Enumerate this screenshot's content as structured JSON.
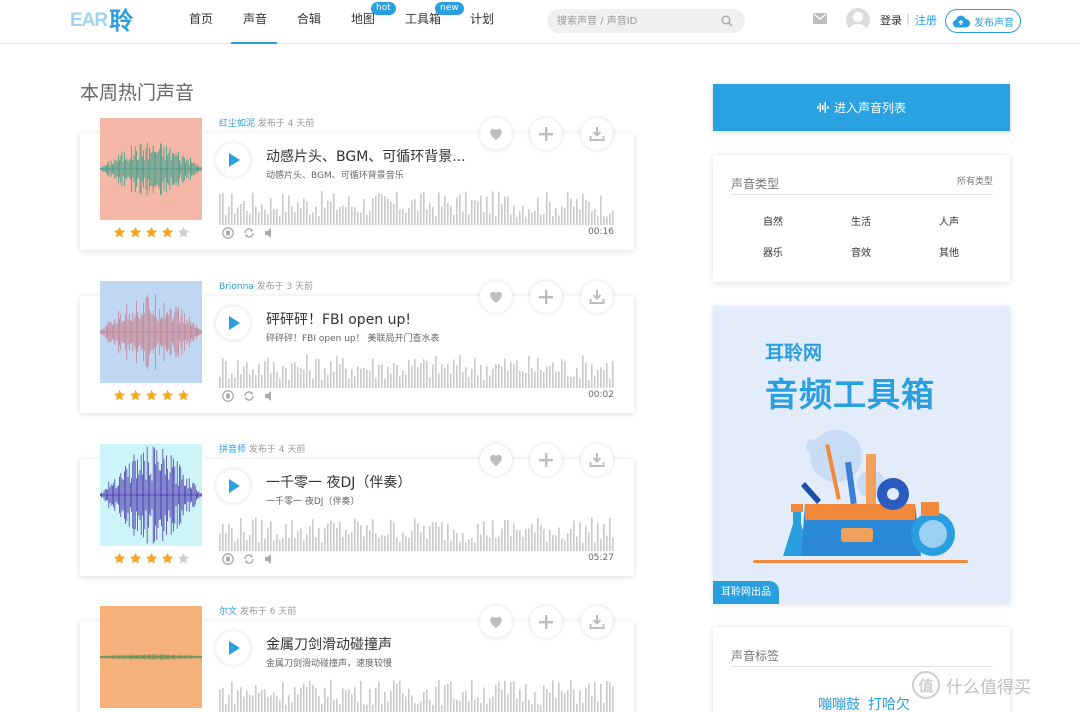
{
  "nav": {
    "logo_text": "EAR",
    "logo_char": "聆",
    "items": [
      {
        "label": "首页"
      },
      {
        "label": "声音"
      },
      {
        "label": "合辑"
      },
      {
        "label": "地图",
        "badge": "hot"
      },
      {
        "label": "工具箱",
        "badge": "new"
      },
      {
        "label": "计划"
      }
    ],
    "search_placeholder": "搜索声音 / 声音ID",
    "login": "登录",
    "separator": "|",
    "register": "注册",
    "publish": "发布声音"
  },
  "section_title": "本周热门声音",
  "sounds": [
    {
      "author": "红尘如泥",
      "posted": "发布于 4 天前",
      "title": "动感片头、BGM、可循环背景...",
      "subtitle": "动感片头、BGM、可循环背景音乐",
      "duration": "00:16",
      "rating": 4,
      "cover_bg": "#f6b8a6",
      "cover_wave": "#1c9c88"
    },
    {
      "author": "Brionna",
      "posted": "发布于 3 天前",
      "title": "砰砰砰！FBI open up!",
      "subtitle": "砰砰砰！FBI open up！ 美联局开门查水表",
      "duration": "00:02",
      "rating": 5,
      "cover_bg": "#c0d7f3",
      "cover_wave": "#c9727c"
    },
    {
      "author": "拼音师",
      "posted": "发布于 4 天前",
      "title": "一千零一 夜DJ（伴奏）",
      "subtitle": "一千零一 夜DJ（伴奏）",
      "duration": "05:27",
      "rating": 4,
      "cover_bg": "#cdf5f9",
      "cover_wave": "#3a1fa6"
    },
    {
      "author": "尔文",
      "posted": "发布于 6 天前",
      "title": "金属刀剑滑动碰撞声",
      "subtitle": "金属刀剑滑动碰撞声，速度较慢",
      "duration": "",
      "rating": 0,
      "cover_bg": "#f6b07a",
      "cover_wave": "#3f8a58"
    }
  ],
  "sidebar": {
    "enter_list": "进入声音列表",
    "types_title": "声音类型",
    "types_all": "所有类型",
    "types": [
      "自然",
      "生活",
      "人声",
      "器乐",
      "音效",
      "其他"
    ],
    "promo_line1": "耳聆网",
    "promo_line2": "音频工具箱",
    "promo_tag": "耳聆网出品",
    "tags_title": "声音标签",
    "tags": [
      "嘣嘣鼓",
      "打哈欠"
    ]
  },
  "watermark": {
    "symbol": "值",
    "text": "什么值得买"
  },
  "colors": {
    "accent": "#2a9fe0",
    "star": "#f5a623",
    "wave_bar": "#c9c9c9"
  }
}
